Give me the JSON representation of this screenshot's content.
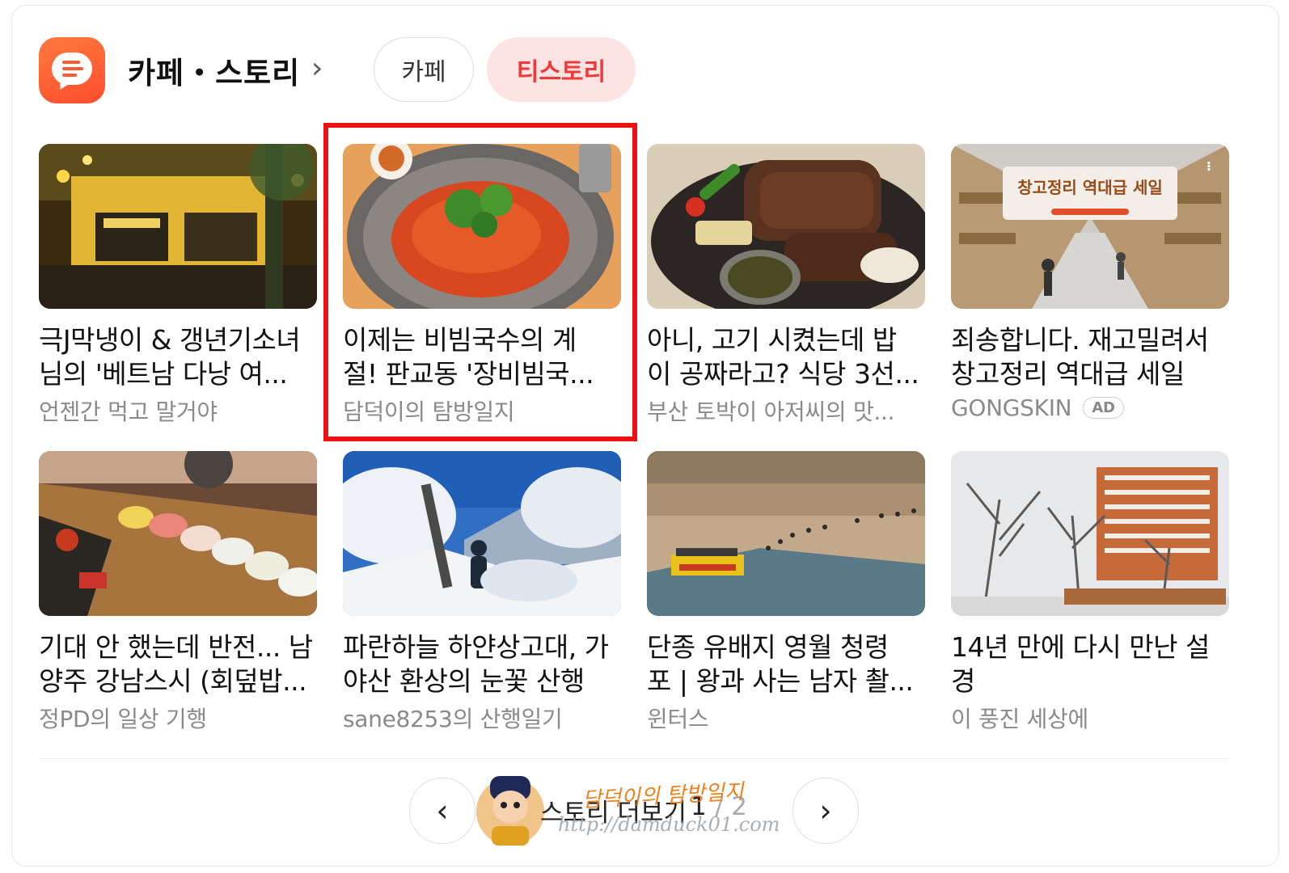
{
  "header": {
    "title": "카페・스토리",
    "chevron": "›",
    "tabs": [
      {
        "label": "카페",
        "selected": false
      },
      {
        "label": "티스토리",
        "selected": true
      }
    ],
    "accent_color": "#ff5a32",
    "selected_tab_color": "#f03a3a"
  },
  "cards": [
    {
      "title": "극J막냉이 & 갱년기소녀님의 '베트남 다낭 여...",
      "line1": "극J막냉이 & 갱년기소녀",
      "line2": "님의 '베트남 다낭 여...",
      "source": "언젠간 먹고 말거야",
      "image": "vietnam-cafe-photo"
    },
    {
      "title": "이제는 비빔국수의 계절! 판교동 '장비빔국...",
      "line1": "이제는 비빔국수의 계",
      "line2": "절! 판교동 '장비빔국...",
      "source": "담덕이의 탐방일지",
      "image": "bibim-noodles-photo",
      "highlighted": true
    },
    {
      "title": "아니, 고기 시켰는데 밥이 공짜라고? 식당 3선...",
      "line1": "아니, 고기 시켰는데 밥",
      "line2": "이 공짜라고? 식당 3선...",
      "source": "부산 토박이 아저씨의 맛...",
      "image": "grilled-meat-photo"
    },
    {
      "title": "죄송합니다. 재고밀려서 창고정리 역대급 세일",
      "line1": "죄송합니다. 재고밀려서",
      "line2": "창고정리 역대급 세일",
      "source": "GONGSKIN",
      "badge": "AD",
      "image": "warehouse-sale-ad",
      "ad_headline": "창고정리 역대급 세일"
    },
    {
      "title": "기대 안 했는데 반전... 남양주 강남스시 (회덮밥...",
      "line1": "기대 안 했는데 반전... 남",
      "line2": "양주 강남스시 (회덮밥...",
      "source": "정PD의 일상 기행",
      "image": "sushi-photo"
    },
    {
      "title": "파란하늘 하얀상고대, 가야산 환상의 눈꽃 산행",
      "line1": "파란하늘 하얀상고대, 가",
      "line2": "야산 환상의 눈꽃 산행",
      "source": "sane8253의 산행일기",
      "image": "snow-mountain-photo"
    },
    {
      "title": "단종 유배지 영월 청령포 | 왕과 사는 남자 촬...",
      "line1": "단종 유배지 영월 청령",
      "line2": "포 | 왕과 사는 남자 촬...",
      "source": "윈터스",
      "image": "riverside-photo"
    },
    {
      "title": "14년 만에 다시 만난 설경",
      "line1": "14년 만에 다시 만난 설",
      "line2": "경",
      "source": "이 풍진 세상에",
      "image": "snowy-apartment-photo"
    }
  ],
  "pagination": {
    "prev": "‹",
    "next": "›",
    "more_label": "스토리 더보기",
    "current_page": "1",
    "total_pages": "/ 2"
  },
  "watermark": {
    "name": "담덕이의 탐방일지",
    "url": "http://damduck01.com"
  }
}
